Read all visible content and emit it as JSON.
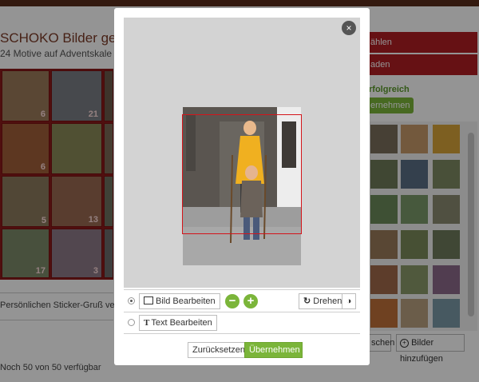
{
  "background_page": {
    "title": "SCHOKO Bilder ges",
    "subtitle": "24 Motive auf Adventskale",
    "calendar_numbers": [
      "6",
      "21",
      "6",
      "5",
      "13",
      "17",
      "3"
    ],
    "sticker_text": "Persönlichen Sticker-Gruß verfas",
    "footer_text": "Noch 50 von 50 verfügbar",
    "right_buttons": [
      "ählen",
      "aden"
    ],
    "success_text": "rfolgreich",
    "apply_partial": "ernehmen",
    "bottom_btn_1": "schen",
    "bottom_btn_2": "Bilder hinzufügen"
  },
  "modal": {
    "close_icon": "×",
    "options": {
      "edit_image_label": "Bild Bearbeiten",
      "zoom_out": "−",
      "zoom_in": "+",
      "rotate_label": "Drehen",
      "contrast_icon": "◑",
      "edit_text_label": "Text Bearbeiten"
    },
    "buttons": {
      "reset": "Zurücksetzen",
      "apply": "Übernehmen"
    }
  },
  "colors": {
    "brand_red": "#b01e24",
    "accent_green": "#7bb53a",
    "crop_frame": "#d4141a"
  }
}
